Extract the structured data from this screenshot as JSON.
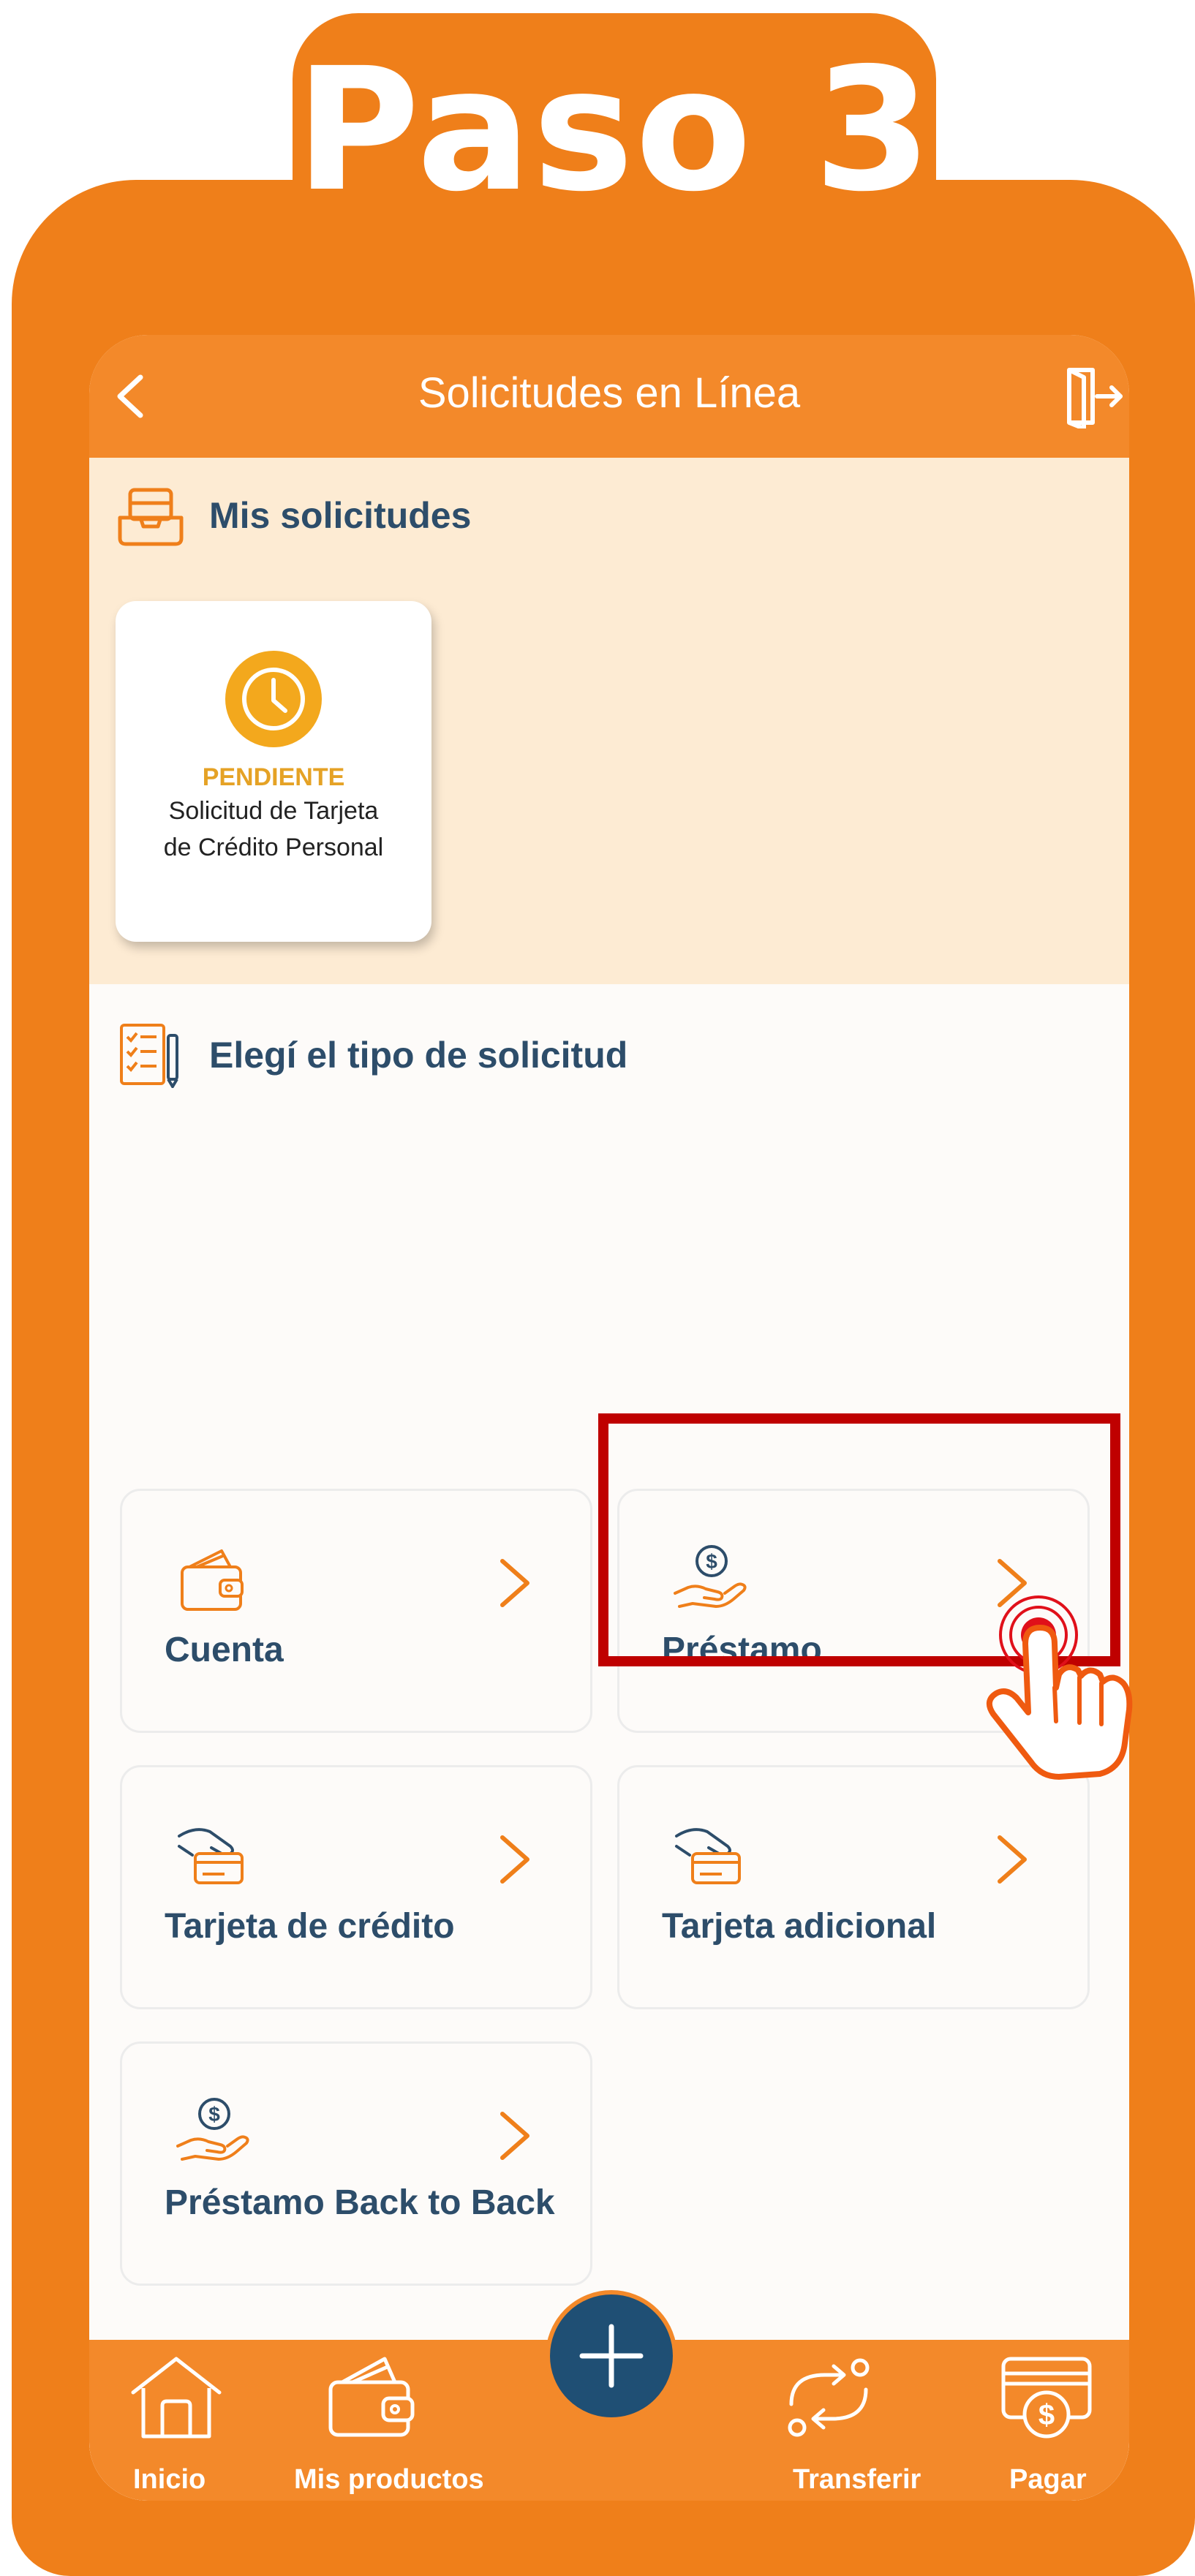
{
  "step": {
    "title": "Paso 3"
  },
  "header": {
    "title": "Solicitudes en Línea"
  },
  "my_requests": {
    "title": "Mis solicitudes",
    "card": {
      "status": "PENDIENTE",
      "description_line1": "Solicitud de Tarjeta",
      "description_line2": "de Crédito Personal"
    }
  },
  "request_types": {
    "title": "Elegí el tipo de solicitud",
    "options": [
      {
        "label": "Cuenta",
        "icon": "wallet-icon"
      },
      {
        "label": "Préstamo",
        "icon": "loan-hand-dollar-icon"
      },
      {
        "label": "Tarjeta de crédito",
        "icon": "card-in-hand-icon"
      },
      {
        "label": "Tarjeta adicional",
        "icon": "card-in-hand-icon",
        "highlighted": true
      },
      {
        "label": "Préstamo Back to Back",
        "icon": "loan-hand-dollar-icon"
      }
    ]
  },
  "bottom_nav": [
    {
      "label": "Inicio",
      "icon": "home-icon"
    },
    {
      "label": "Mis productos",
      "icon": "wallet-icon"
    },
    {
      "label": "Transferir",
      "icon": "transfer-icon"
    },
    {
      "label": "Pagar",
      "icon": "pay-icon"
    }
  ],
  "colors": {
    "frame_orange": "#ef7f1a",
    "header_orange": "#f3892a",
    "requests_bg": "#fdebd3",
    "text_navy": "#2d4d6a",
    "pending": "#e5a225",
    "highlight_red": "#bf0000",
    "fab_blue": "#1f4f74"
  }
}
